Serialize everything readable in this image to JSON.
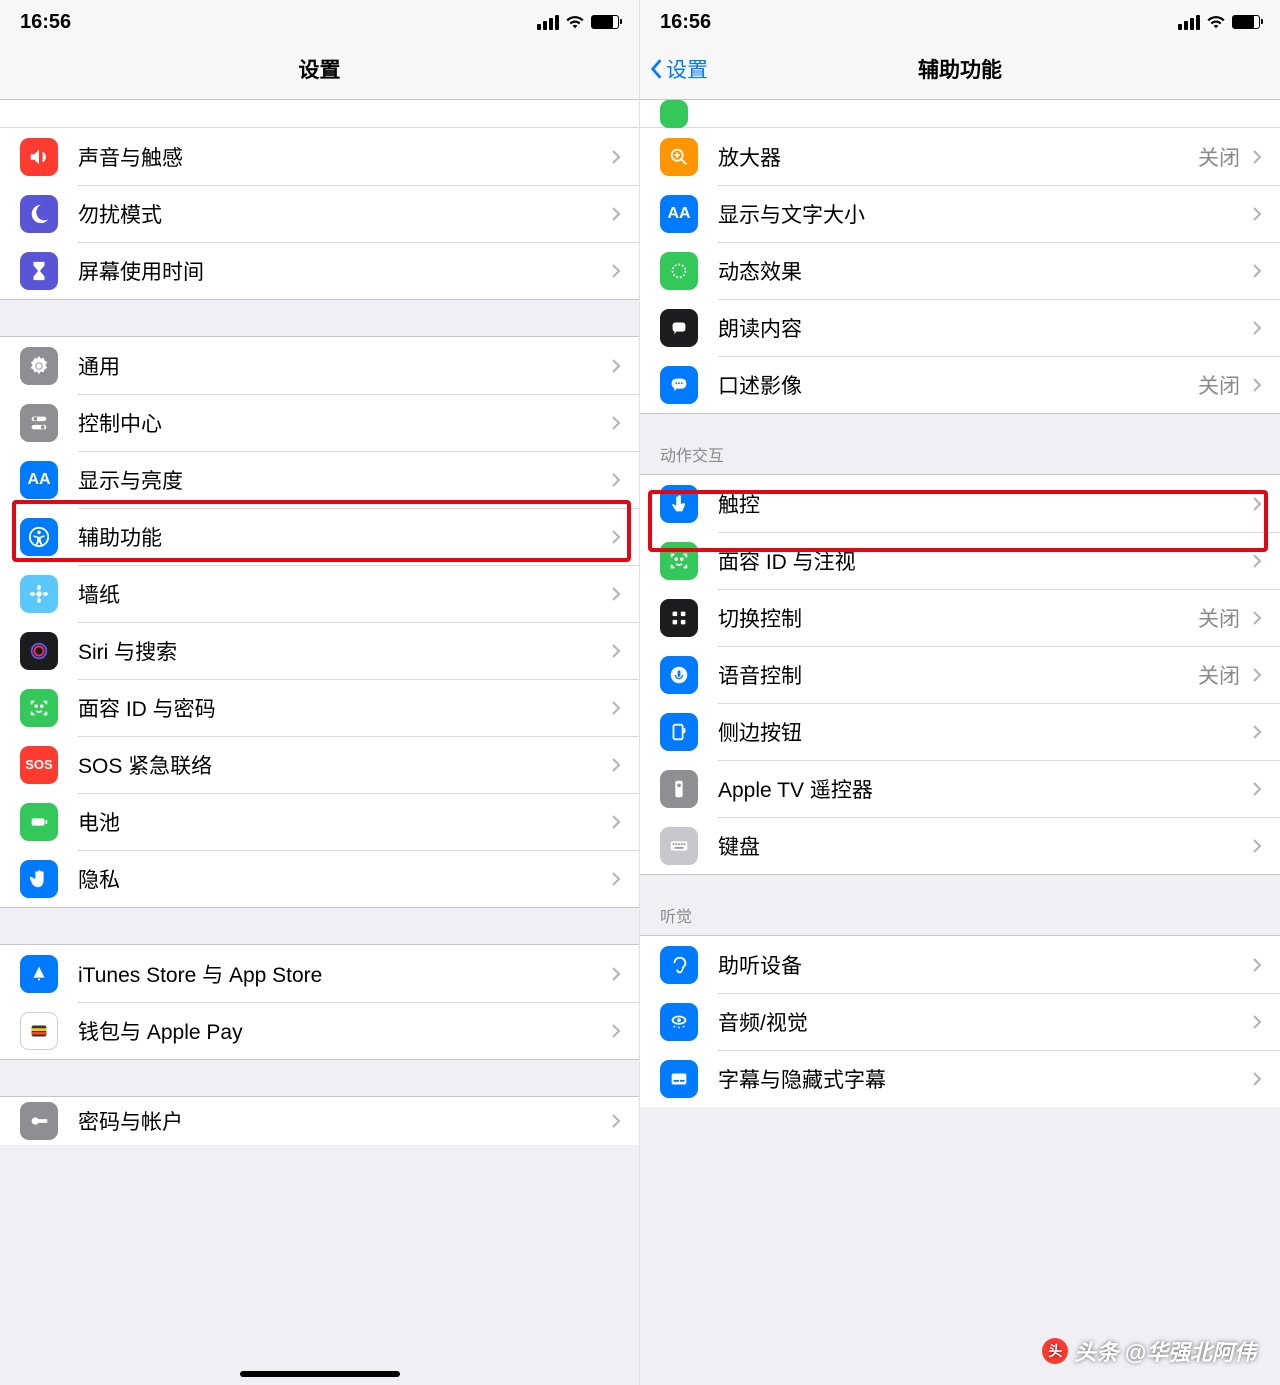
{
  "status": {
    "time": "16:56"
  },
  "left": {
    "title": "设置",
    "groups": [
      {
        "items": [
          {
            "icon": "sound-icon",
            "color": "c-red",
            "label": "声音与触感"
          },
          {
            "icon": "moon-icon",
            "color": "c-purple",
            "label": "勿扰模式"
          },
          {
            "icon": "hourglass-icon",
            "color": "c-purple",
            "label": "屏幕使用时间"
          }
        ]
      },
      {
        "items": [
          {
            "icon": "gear-icon",
            "color": "c-gray",
            "label": "通用"
          },
          {
            "icon": "switches-icon",
            "color": "c-gray",
            "label": "控制中心"
          },
          {
            "icon": "aa-icon",
            "color": "c-blue",
            "label": "显示与亮度"
          },
          {
            "icon": "accessibility-icon",
            "color": "c-blue",
            "label": "辅助功能",
            "highlight": true
          },
          {
            "icon": "flower-icon",
            "color": "c-lgray",
            "label": "墙纸"
          },
          {
            "icon": "siri-icon",
            "color": "c-black",
            "label": "Siri 与搜索"
          },
          {
            "icon": "faceid-icon",
            "color": "c-green",
            "label": "面容 ID 与密码"
          },
          {
            "icon": "sos-icon",
            "color": "c-red",
            "label": "SOS 紧急联络"
          },
          {
            "icon": "battery-icon",
            "color": "c-green",
            "label": "电池"
          },
          {
            "icon": "hand-icon",
            "color": "c-blue",
            "label": "隐私"
          }
        ]
      },
      {
        "items": [
          {
            "icon": "appstore-icon",
            "color": "c-blue",
            "label": "iTunes Store 与 App Store"
          },
          {
            "icon": "wallet-icon",
            "color": "c-white",
            "label": "钱包与 Apple Pay"
          }
        ]
      },
      {
        "items": [
          {
            "icon": "key-icon",
            "color": "c-gray",
            "label": "密码与帐户"
          }
        ],
        "partial": true
      }
    ]
  },
  "right": {
    "back": "设置",
    "title": "辅助功能",
    "off_label": "关闭",
    "sections": [
      {
        "header": null,
        "items": [
          {
            "icon": "magnifier-icon",
            "color": "c-orange",
            "label": "放大器",
            "value": "关闭"
          },
          {
            "icon": "aa-icon",
            "color": "c-blue",
            "label": "显示与文字大小"
          },
          {
            "icon": "motion-icon",
            "color": "c-green",
            "label": "动态效果"
          },
          {
            "icon": "speech-icon",
            "color": "c-black",
            "label": "朗读内容"
          },
          {
            "icon": "bubble-icon",
            "color": "c-blue",
            "label": "口述影像",
            "value": "关闭"
          }
        ],
        "has_partial_top": true
      },
      {
        "header": "动作交互",
        "items": [
          {
            "icon": "touch-icon",
            "color": "c-blue",
            "label": "触控",
            "highlight": true
          },
          {
            "icon": "faceid-icon",
            "color": "c-green",
            "label": "面容 ID 与注视"
          },
          {
            "icon": "grid-icon",
            "color": "c-black",
            "label": "切换控制",
            "value": "关闭"
          },
          {
            "icon": "voice-icon",
            "color": "c-blue",
            "label": "语音控制",
            "value": "关闭"
          },
          {
            "icon": "sidebtn-icon",
            "color": "c-blue",
            "label": "侧边按钮"
          },
          {
            "icon": "remote-icon",
            "color": "c-gray",
            "label": "Apple TV 遥控器"
          },
          {
            "icon": "keyboard-icon",
            "color": "c-kb",
            "label": "键盘"
          }
        ]
      },
      {
        "header": "听觉",
        "items": [
          {
            "icon": "ear-icon",
            "color": "c-blue",
            "label": "助听设备"
          },
          {
            "icon": "av-icon",
            "color": "c-blue",
            "label": "音频/视觉"
          },
          {
            "icon": "caption-icon",
            "color": "c-blue",
            "label": "字幕与隐藏式字幕"
          }
        ],
        "partial_bottom": true
      }
    ]
  },
  "watermark": "头条 @华强北阿伟"
}
